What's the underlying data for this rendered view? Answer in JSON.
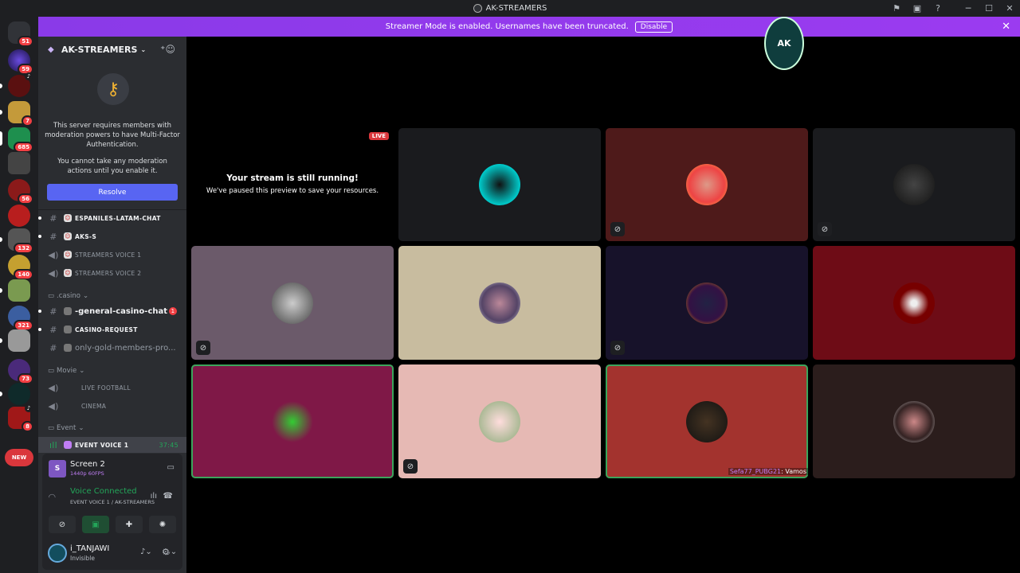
{
  "window": {
    "title": "AK-STREAMERS"
  },
  "banner": {
    "text": "Streamer Mode is enabled. Usernames have been truncated.",
    "button": "Disable"
  },
  "server_list": {
    "badges": [
      "51",
      "59",
      "",
      "7",
      "685",
      "",
      "56",
      "",
      "132",
      "140",
      "",
      "321",
      "",
      "73",
      "",
      "8"
    ],
    "new_label": "NEW"
  },
  "server": {
    "name": "AK-STREAMERS"
  },
  "mfa": {
    "line1": "This server requires members with moderation powers to have Multi-Factor Authentication.",
    "line2": "You cannot take any moderation actions until you enable it.",
    "button": "Resolve"
  },
  "channels": [
    {
      "name": "ESPANILES-LATAM-CHAT",
      "icon": "hash"
    },
    {
      "name": "AKS-S",
      "icon": "hash"
    },
    {
      "name": "STREAMERS VOICE 1",
      "icon": "speaker"
    },
    {
      "name": "STREAMERS VOICE 2",
      "icon": "speaker"
    }
  ],
  "categories": {
    "casino": ".casino",
    "movie": "Movie",
    "event": "Event"
  },
  "casino_channels": [
    {
      "name": "-general-casino-chat",
      "mentions": "1"
    },
    {
      "name": "CASINO-REQUEST"
    },
    {
      "name": "only-gold-members-pro..."
    }
  ],
  "movie_channels": [
    {
      "name": "LIVE FOOTBALL"
    },
    {
      "name": "CINEMA"
    }
  ],
  "event_channel": {
    "name": "EVENT VOICE 1",
    "timer": "37:45"
  },
  "stream_panel": {
    "title": "Screen 2",
    "quality": "1440p 60FPS",
    "avatar_letter": "S"
  },
  "voice": {
    "status": "Voice Connected",
    "location": "EVENT VOICE 1 / AK-STREAMERS"
  },
  "user": {
    "name": "i_TANJAWI",
    "status": "Invisible"
  },
  "stage": {
    "live_badge": "LIVE",
    "paused_title": "Your stream is still running!",
    "paused_sub": "We've paused this preview to save your resources.",
    "speaker_tag_name": "Sefa77_PUBG21",
    "speaker_tag_text": ": Vamos"
  },
  "logo": {
    "text": "AK"
  },
  "colors": {
    "accent": "#5865f2",
    "banner": "#8a3ae8",
    "voice_green": "#23a559",
    "danger": "#da373c"
  }
}
